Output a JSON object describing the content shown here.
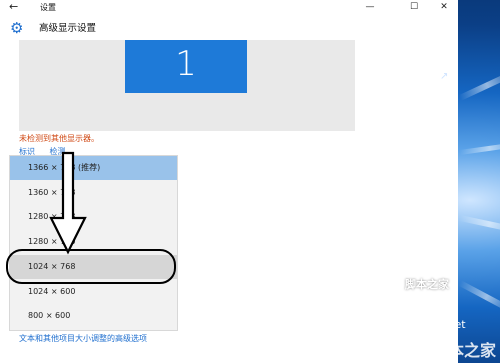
{
  "window": {
    "title": "设置",
    "back_icon": "←",
    "minimize_icon": "—",
    "maximize_icon": "☐",
    "close_icon": "✕"
  },
  "header": {
    "gear_icon": "⚙",
    "title": "高级显示设置"
  },
  "preview": {
    "monitor_number": "1",
    "monitor_color": "#1e7ad8"
  },
  "warning": "未检测到其他显示器。",
  "links": {
    "identify": "标识",
    "detect": "检测"
  },
  "resolutions": [
    {
      "label": "1366 × 768 (推荐)",
      "state": "selected"
    },
    {
      "label": "1360 × 768",
      "state": ""
    },
    {
      "label": "1280 × 768",
      "state": ""
    },
    {
      "label": "1280 × 720",
      "state": ""
    },
    {
      "label": "1024 × 768",
      "state": "highlighted"
    },
    {
      "label": "1024 × 600",
      "state": ""
    },
    {
      "label": "800 × 600",
      "state": ""
    }
  ],
  "advanced_link": "文本和其他项目大小调整的高级选项",
  "watermarks": {
    "site": "jb51.net",
    "brand_small": "脚本之家",
    "brand_large": "脚本之家",
    "brand_logo": "↗"
  },
  "colors": {
    "accent": "#1f6fcf",
    "warning": "#d04a16",
    "selected_row": "#99c2ea",
    "highlighted_row": "#d6d6d6"
  }
}
